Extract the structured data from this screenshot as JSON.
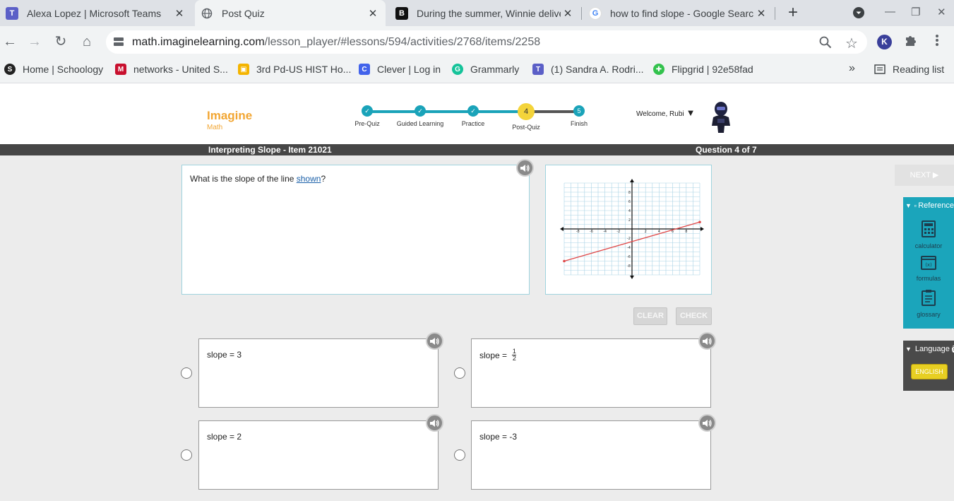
{
  "browser": {
    "tabs": [
      {
        "title": "Alexa Lopez | Microsoft Teams",
        "icon": "teams-icon"
      },
      {
        "title": "Post Quiz",
        "icon": "globe-icon"
      },
      {
        "title": "During the summer, Winnie delive",
        "icon": "brainly-icon"
      },
      {
        "title": "how to find slope - Google Search",
        "icon": "google-icon"
      }
    ],
    "url_host": "math.imaginelearning.com",
    "url_path": "/lesson_player/#lessons/594/activities/2768/items/2258",
    "profile_initial": "K",
    "bookmarks": [
      {
        "label": "Home | Schoology",
        "icon": "schoology-icon"
      },
      {
        "label": "networks - United S...",
        "icon": "mcgraw-hill-icon"
      },
      {
        "label": "3rd Pd-US HIST Ho...",
        "icon": "classroom-icon"
      },
      {
        "label": "Clever | Log in",
        "icon": "clever-icon"
      },
      {
        "label": "Grammarly",
        "icon": "grammarly-icon"
      },
      {
        "label": "(1) Sandra A. Rodri...",
        "icon": "teams-icon"
      },
      {
        "label": "Flipgrid | 92e58fad",
        "icon": "flipgrid-icon"
      }
    ],
    "more_bookmarks": "»",
    "reading_list": "Reading list"
  },
  "app": {
    "logo_title": "Imagine",
    "logo_sub": "Math",
    "steps": [
      {
        "label": "Pre-Quiz",
        "state": "done"
      },
      {
        "label": "Guided Learning",
        "state": "done"
      },
      {
        "label": "Practice",
        "state": "done"
      },
      {
        "label": "Post-Quiz",
        "state": "current",
        "number": "4"
      },
      {
        "label": "Finish",
        "state": "todo",
        "number": "5"
      }
    ],
    "welcome": "Welcome, Rubi",
    "lesson_title": "Interpreting Slope - Item 21021",
    "question_counter": "Question 4 of 7"
  },
  "question": {
    "text_before": "What is the slope of the line ",
    "link": "shown",
    "text_after": "?"
  },
  "graph": {
    "x_range": [
      -10,
      10
    ],
    "y_range": [
      -10,
      10
    ],
    "x_ticks": [
      "-8",
      "-6",
      "-4",
      "-2",
      "2",
      "4",
      "6",
      "8"
    ],
    "y_ticks": [
      "8",
      "6",
      "4",
      "2",
      "-2",
      "-4",
      "-6",
      "-8"
    ],
    "line_from": [
      -10,
      -7
    ],
    "line_to": [
      10,
      1.5
    ],
    "line_color": "#e04848",
    "grid_color": "#a9d3e6"
  },
  "actions": {
    "clear": "CLEAR",
    "check": "CHECK",
    "next": "NEXT ▶"
  },
  "answers": [
    {
      "prefix": "slope = ",
      "value": "3"
    },
    {
      "prefix": "slope = ",
      "numerator": "1",
      "denominator": "2"
    },
    {
      "prefix": "slope = ",
      "value": "2"
    },
    {
      "prefix": "slope = ",
      "value": "-3"
    }
  ],
  "reference": {
    "title": "Reference",
    "tools": [
      {
        "label": "calculator",
        "icon": "calculator-icon"
      },
      {
        "label": "formulas",
        "icon": "formulas-icon"
      },
      {
        "label": "glossary",
        "icon": "glossary-icon"
      }
    ]
  },
  "language": {
    "title": "Language",
    "button": "ENGLISH"
  }
}
